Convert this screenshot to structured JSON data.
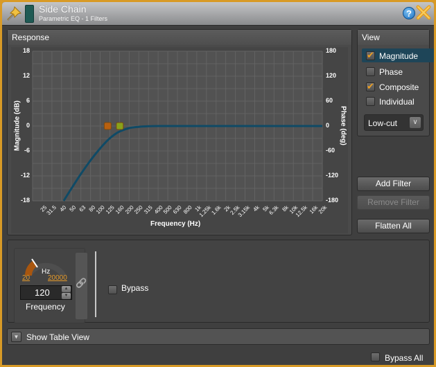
{
  "window": {
    "title": "Side Chain",
    "subtitle": "Parametric EQ - 1 Filters",
    "accent_color": "#d89a26",
    "color_swatch": "#1f5a54",
    "icons": {
      "pin": "pushpin-icon",
      "help": "help-icon",
      "close": "close-icon"
    },
    "help_glyph": "?"
  },
  "response": {
    "title": "Response"
  },
  "chart_data": {
    "type": "line",
    "title": "Response",
    "xlabel": "Frequency (Hz)",
    "ylabel": "Magnitude (dB)",
    "y2label": "Phase (deg)",
    "xscale": "log",
    "xlim": [
      20,
      20000
    ],
    "ylim": [
      -18,
      18
    ],
    "y2lim": [
      -180,
      180
    ],
    "yticks": [
      18,
      12,
      6,
      0,
      -6,
      -12,
      -18
    ],
    "y2ticks": [
      180,
      120,
      60,
      0,
      -60,
      -120,
      -180
    ],
    "xticks": [
      "25",
      "31.5",
      "40",
      "50",
      "63",
      "80",
      "100",
      "125",
      "160",
      "200",
      "250",
      "315",
      "400",
      "500",
      "630",
      "800",
      "1k",
      "1.25k",
      "1.6k",
      "2k",
      "2.5k",
      "3.15k",
      "4k",
      "5k",
      "6.3k",
      "8k",
      "10k",
      "12.5k",
      "16k",
      "20k"
    ],
    "xtick_values": [
      25,
      31.5,
      40,
      50,
      63,
      80,
      100,
      125,
      160,
      200,
      250,
      315,
      400,
      500,
      630,
      800,
      1000,
      1250,
      1600,
      2000,
      2500,
      3150,
      4000,
      5000,
      6300,
      8000,
      10000,
      12500,
      16000,
      20000
    ],
    "grid": true,
    "series": [
      {
        "name": "Composite magnitude",
        "color": "#0f4a66",
        "x": [
          42,
          50,
          63,
          80,
          100,
          120,
          140,
          160,
          200,
          250,
          315,
          400,
          630,
          1000,
          5000,
          20000
        ],
        "y": [
          -18,
          -15.2,
          -11.6,
          -8.2,
          -5.4,
          -3.4,
          -2.1,
          -1.3,
          -0.5,
          -0.2,
          -0.05,
          0,
          0,
          0,
          0,
          0
        ]
      }
    ],
    "handles": [
      {
        "name": "filter-1-frequency",
        "freq_hz": 120,
        "gain_db": 0,
        "color": "#b8600f"
      },
      {
        "name": "filter-1-secondary",
        "freq_hz": 160,
        "gain_db": 0,
        "color": "#8aa21a"
      }
    ]
  },
  "view": {
    "title": "View",
    "options": [
      {
        "label": "Magnitude",
        "checked": true,
        "selected": true
      },
      {
        "label": "Phase",
        "checked": false,
        "selected": false
      },
      {
        "label": "Composite",
        "checked": true,
        "selected": false
      },
      {
        "label": "Individual",
        "checked": false,
        "selected": false
      }
    ],
    "filter_type": "Low-cut",
    "dropdown_glyph": "∨"
  },
  "buttons": {
    "add_filter": "Add Filter",
    "remove_filter": "Remove Filter",
    "flatten_all": "Flatten All"
  },
  "filter": {
    "dial_unit": "Hz",
    "dial_min": "20",
    "dial_max": "20000",
    "value": "120",
    "label": "Frequency",
    "link_glyph": "🔗",
    "bypass_label": "Bypass",
    "bypass_checked": false
  },
  "table_view": {
    "label": "Show Table View"
  },
  "footer": {
    "bypass_all_label": "Bypass All",
    "bypass_all_checked": false
  }
}
